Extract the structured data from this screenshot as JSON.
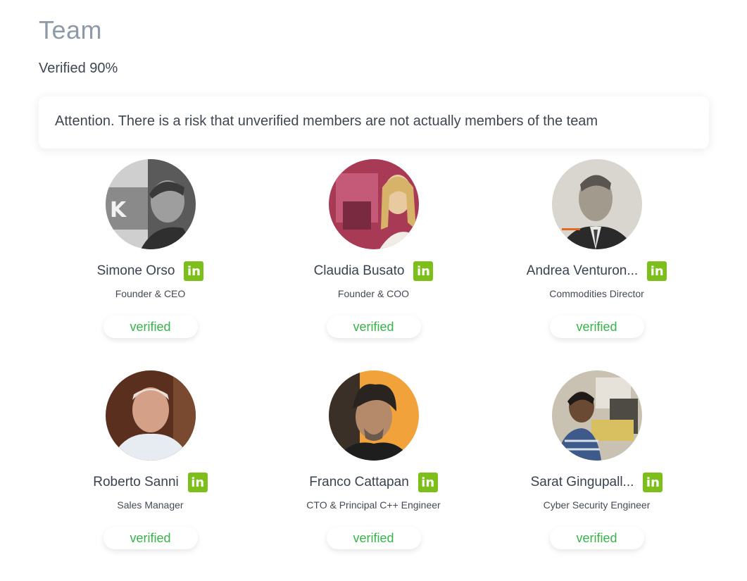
{
  "page": {
    "title": "Team",
    "verified_summary": "Verified 90%",
    "alert": "Attention. There is a risk that unverified members are not actually members of the team"
  },
  "colors": {
    "accent_green": "#38b24a",
    "linkedin_badge": "#7cbf1a",
    "title_gray": "#8f9aa6"
  },
  "linkedin_icon": {
    "label": "in",
    "icon": "linkedin-icon"
  },
  "members": [
    {
      "name": "Simone Orso",
      "role": "Founder & CEO",
      "status": "verified"
    },
    {
      "name": "Claudia Busato",
      "role": "Founder & COO",
      "status": "verified"
    },
    {
      "name": "Andrea Venturon...",
      "role": "Commodities Director",
      "status": "verified"
    },
    {
      "name": "Roberto Sanni",
      "role": "Sales Manager",
      "status": "verified"
    },
    {
      "name": "Franco Cattapan",
      "role": "CTO & Principal C++ Engineer",
      "status": "verified"
    },
    {
      "name": "Sarat Gingupall...",
      "role": "Cyber Security Engineer",
      "status": "verified"
    }
  ]
}
